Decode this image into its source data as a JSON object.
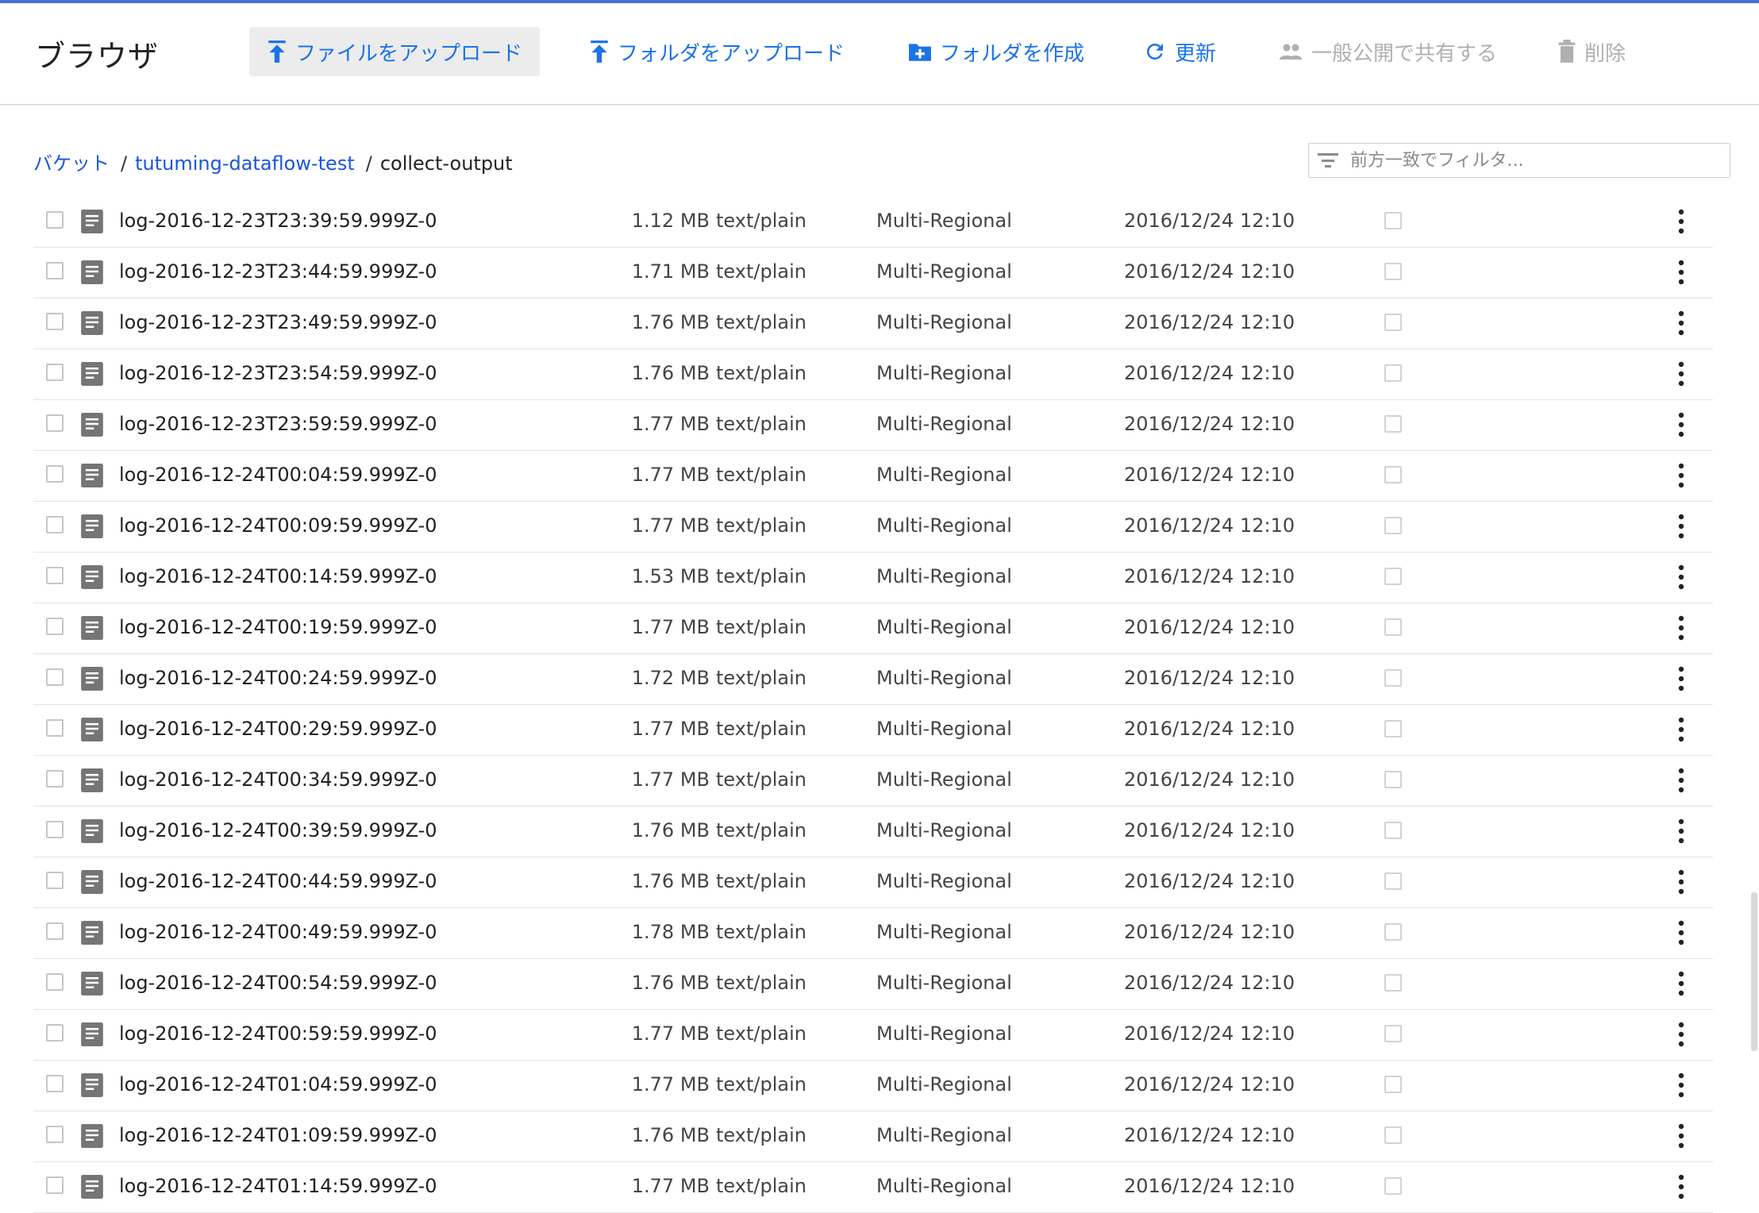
{
  "header": {
    "title": "ブラウザ",
    "buttons": {
      "upload_files": "ファイルをアップロード",
      "upload_folder": "フォルダをアップロード",
      "create_folder": "フォルダを作成",
      "refresh": "更新",
      "share_public": "一般公開で共有する",
      "delete": "削除"
    }
  },
  "breadcrumb": {
    "bucket": "バケット",
    "bucket_name": "tutuming-dataflow-test",
    "folder": "collect-output",
    "separator": "/"
  },
  "filter": {
    "placeholder": "前方一致でフィルタ..."
  },
  "colors": {
    "accent": "#1a73e8",
    "top_bar": "#4a72d4",
    "disabled": "#b0b0b0"
  },
  "rows": [
    {
      "name": "log-2016-12-23T23:39:59.999Z-0",
      "size": "1.12 MB",
      "type": "text/plain",
      "storage_class": "Multi-Regional",
      "updated": "2016/12/24 12:10"
    },
    {
      "name": "log-2016-12-23T23:44:59.999Z-0",
      "size": "1.71 MB",
      "type": "text/plain",
      "storage_class": "Multi-Regional",
      "updated": "2016/12/24 12:10"
    },
    {
      "name": "log-2016-12-23T23:49:59.999Z-0",
      "size": "1.76 MB",
      "type": "text/plain",
      "storage_class": "Multi-Regional",
      "updated": "2016/12/24 12:10"
    },
    {
      "name": "log-2016-12-23T23:54:59.999Z-0",
      "size": "1.76 MB",
      "type": "text/plain",
      "storage_class": "Multi-Regional",
      "updated": "2016/12/24 12:10"
    },
    {
      "name": "log-2016-12-23T23:59:59.999Z-0",
      "size": "1.77 MB",
      "type": "text/plain",
      "storage_class": "Multi-Regional",
      "updated": "2016/12/24 12:10"
    },
    {
      "name": "log-2016-12-24T00:04:59.999Z-0",
      "size": "1.77 MB",
      "type": "text/plain",
      "storage_class": "Multi-Regional",
      "updated": "2016/12/24 12:10"
    },
    {
      "name": "log-2016-12-24T00:09:59.999Z-0",
      "size": "1.77 MB",
      "type": "text/plain",
      "storage_class": "Multi-Regional",
      "updated": "2016/12/24 12:10"
    },
    {
      "name": "log-2016-12-24T00:14:59.999Z-0",
      "size": "1.53 MB",
      "type": "text/plain",
      "storage_class": "Multi-Regional",
      "updated": "2016/12/24 12:10"
    },
    {
      "name": "log-2016-12-24T00:19:59.999Z-0",
      "size": "1.77 MB",
      "type": "text/plain",
      "storage_class": "Multi-Regional",
      "updated": "2016/12/24 12:10"
    },
    {
      "name": "log-2016-12-24T00:24:59.999Z-0",
      "size": "1.72 MB",
      "type": "text/plain",
      "storage_class": "Multi-Regional",
      "updated": "2016/12/24 12:10"
    },
    {
      "name": "log-2016-12-24T00:29:59.999Z-0",
      "size": "1.77 MB",
      "type": "text/plain",
      "storage_class": "Multi-Regional",
      "updated": "2016/12/24 12:10"
    },
    {
      "name": "log-2016-12-24T00:34:59.999Z-0",
      "size": "1.77 MB",
      "type": "text/plain",
      "storage_class": "Multi-Regional",
      "updated": "2016/12/24 12:10"
    },
    {
      "name": "log-2016-12-24T00:39:59.999Z-0",
      "size": "1.76 MB",
      "type": "text/plain",
      "storage_class": "Multi-Regional",
      "updated": "2016/12/24 12:10"
    },
    {
      "name": "log-2016-12-24T00:44:59.999Z-0",
      "size": "1.76 MB",
      "type": "text/plain",
      "storage_class": "Multi-Regional",
      "updated": "2016/12/24 12:10"
    },
    {
      "name": "log-2016-12-24T00:49:59.999Z-0",
      "size": "1.78 MB",
      "type": "text/plain",
      "storage_class": "Multi-Regional",
      "updated": "2016/12/24 12:10"
    },
    {
      "name": "log-2016-12-24T00:54:59.999Z-0",
      "size": "1.76 MB",
      "type": "text/plain",
      "storage_class": "Multi-Regional",
      "updated": "2016/12/24 12:10"
    },
    {
      "name": "log-2016-12-24T00:59:59.999Z-0",
      "size": "1.77 MB",
      "type": "text/plain",
      "storage_class": "Multi-Regional",
      "updated": "2016/12/24 12:10"
    },
    {
      "name": "log-2016-12-24T01:04:59.999Z-0",
      "size": "1.77 MB",
      "type": "text/plain",
      "storage_class": "Multi-Regional",
      "updated": "2016/12/24 12:10"
    },
    {
      "name": "log-2016-12-24T01:09:59.999Z-0",
      "size": "1.76 MB",
      "type": "text/plain",
      "storage_class": "Multi-Regional",
      "updated": "2016/12/24 12:10"
    },
    {
      "name": "log-2016-12-24T01:14:59.999Z-0",
      "size": "1.77 MB",
      "type": "text/plain",
      "storage_class": "Multi-Regional",
      "updated": "2016/12/24 12:10"
    }
  ]
}
